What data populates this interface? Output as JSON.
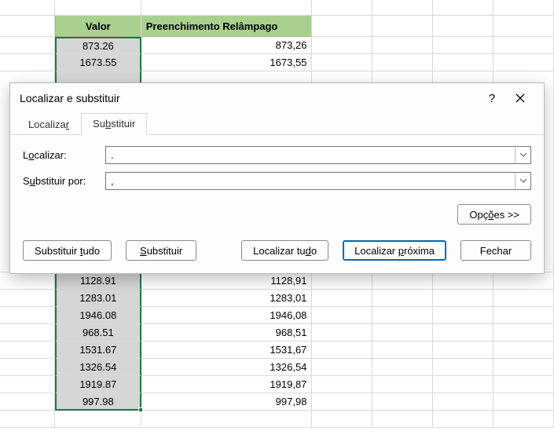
{
  "sheet": {
    "headers": {
      "valor": "Valor",
      "preench": "Preenchimento Relâmpago"
    },
    "rows": [
      {
        "v": "873.26",
        "p": "873,26"
      },
      {
        "v": "1673.55",
        "p": "1673,55"
      },
      {
        "v": "1128.91",
        "p": "1128,91"
      },
      {
        "v": "1283.01",
        "p": "1283,01"
      },
      {
        "v": "1946.08",
        "p": "1946,08"
      },
      {
        "v": "968.51",
        "p": "968,51"
      },
      {
        "v": "1531.67",
        "p": "1531,67"
      },
      {
        "v": "1326.54",
        "p": "1326,54"
      },
      {
        "v": "1919.87",
        "p": "1919,87"
      },
      {
        "v": "997.98",
        "p": "997,98"
      }
    ]
  },
  "dialog": {
    "title": "Localizar e substituir",
    "help": "?",
    "tabs": {
      "find": "Localiza",
      "find_u": "r",
      "replace_pre": "Su",
      "replace_u": "b",
      "replace_post": "stituir"
    },
    "labels": {
      "find_pre": "L",
      "find_u": "o",
      "find_post": "calizar:",
      "replace_pre": "S",
      "replace_u": "u",
      "replace_post": "bstituir por:"
    },
    "values": {
      "find": ".",
      "replace": ","
    },
    "buttons": {
      "options_pre": "Opç",
      "options_u": "õ",
      "options_post": "es >>",
      "replace_all_pre": "Substituir ",
      "replace_all_u": "t",
      "replace_all_post": "udo",
      "replace_pre": "",
      "replace_u": "S",
      "replace_post": "ubstituir",
      "find_all_pre": "Localizar tu",
      "find_all_u": "d",
      "find_all_post": "o",
      "find_next_pre": "Localizar ",
      "find_next_u": "p",
      "find_next_post": "róxima",
      "close": "Fechar"
    }
  }
}
